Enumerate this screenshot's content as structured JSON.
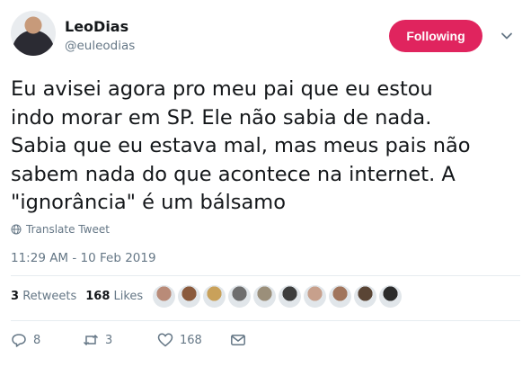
{
  "user": {
    "display_name": "LeoDias",
    "handle": "@euleodias"
  },
  "follow_button": {
    "label": "Following",
    "color": "#e0245e"
  },
  "tweet": {
    "lines": [
      "Eu avisei agora pro meu pai que eu estou",
      "indo morar em SP. Ele não sabia de nada.",
      "Sabia que eu estava mal, mas meus pais não",
      "sabem nada do que acontece na internet. A",
      "\"ignorância\" é um bálsamo"
    ],
    "translate_label": "Translate Tweet",
    "timestamp": "11:29 AM - 10 Feb 2019"
  },
  "stats": {
    "retweets_count": "3",
    "retweets_label": "Retweets",
    "likes_count": "168",
    "likes_label": "Likes"
  },
  "liker_avatars": [
    {
      "icon": "avatar-1",
      "color": "#b98b78"
    },
    {
      "icon": "avatar-2",
      "color": "#8a5a3c"
    },
    {
      "icon": "avatar-3",
      "color": "#c9a15a"
    },
    {
      "icon": "avatar-4",
      "color": "#6e6e6e"
    },
    {
      "icon": "avatar-5",
      "color": "#9b8f7a"
    },
    {
      "icon": "avatar-6",
      "color": "#3d3d3d"
    },
    {
      "icon": "avatar-7",
      "color": "#c7a08c"
    },
    {
      "icon": "avatar-8",
      "color": "#a1755c"
    },
    {
      "icon": "avatar-9",
      "color": "#5a4535"
    },
    {
      "icon": "avatar-10",
      "color": "#2b2b2b"
    }
  ],
  "actions": {
    "reply_count": "8",
    "retweet_count": "3",
    "like_count": "168"
  }
}
